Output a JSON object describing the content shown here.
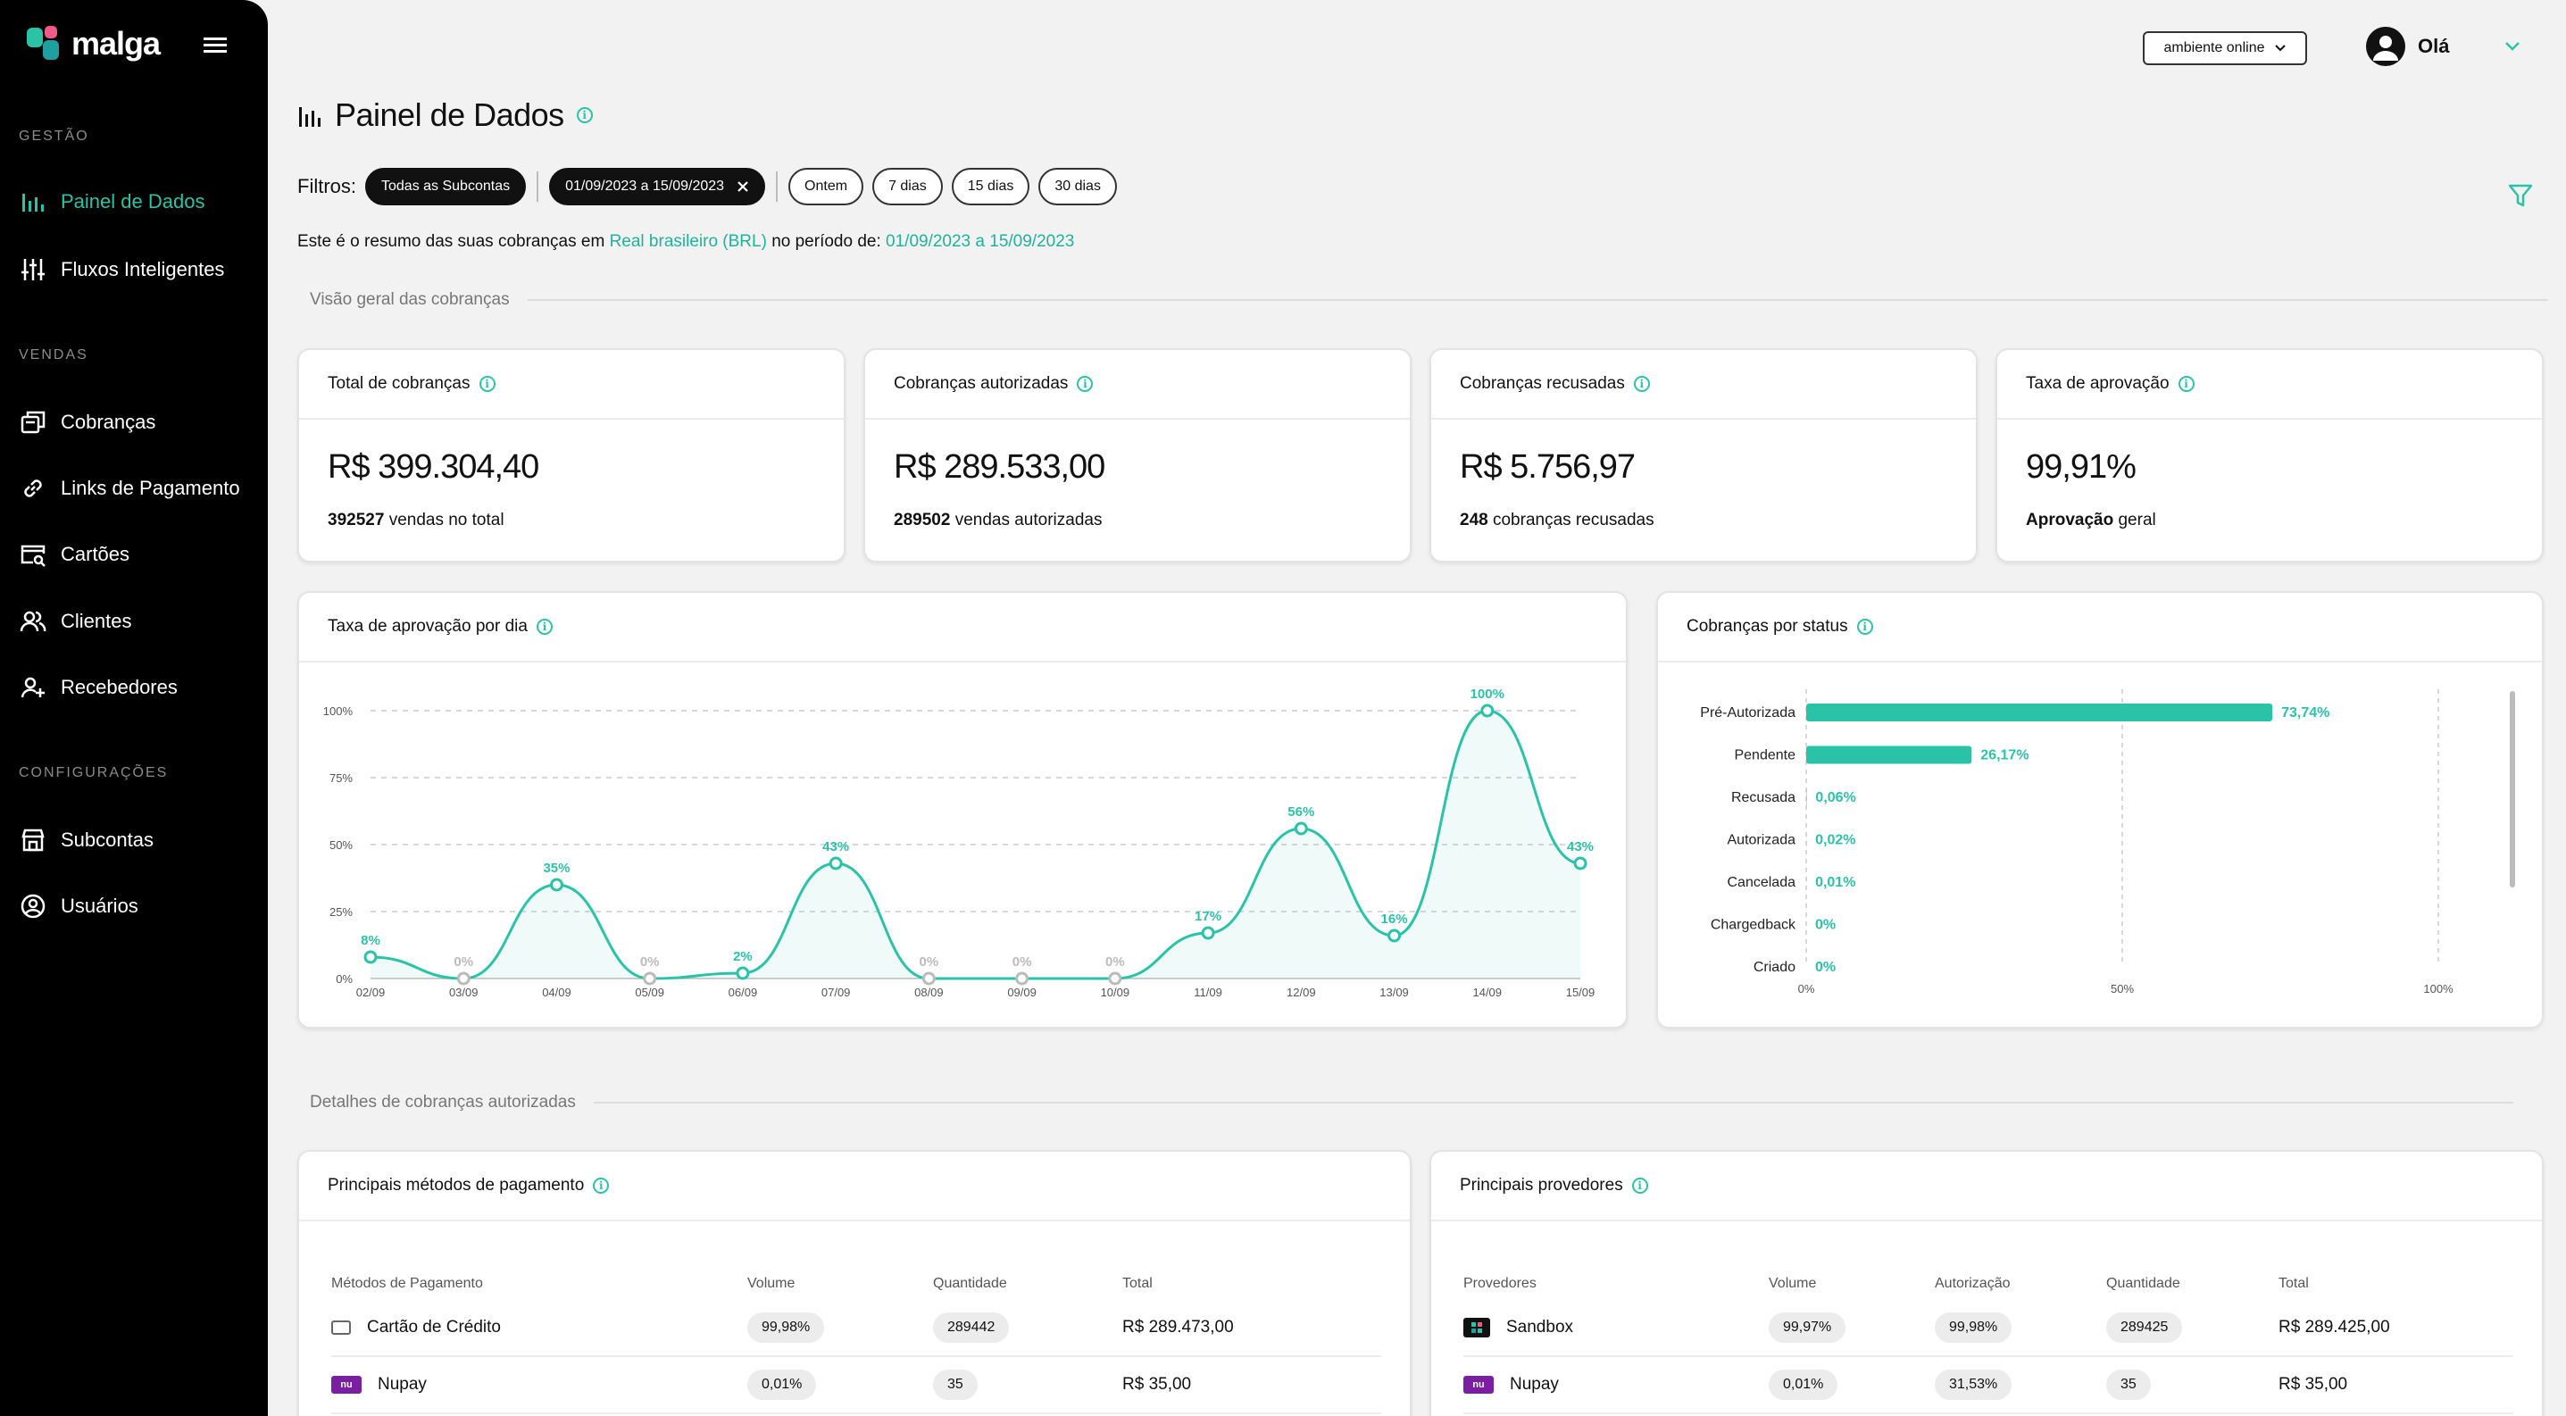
{
  "app": {
    "logo_text": "malga",
    "brand_color": "#2bc3a8"
  },
  "sidebar": {
    "sections": [
      {
        "title": "GESTÃO",
        "items": [
          {
            "label": "Painel de Dados",
            "icon": "bar-chart-icon",
            "active": true
          },
          {
            "label": "Fluxos Inteligentes",
            "icon": "sliders-icon",
            "active": false
          }
        ]
      },
      {
        "title": "VENDAS",
        "items": [
          {
            "label": "Cobranças",
            "icon": "charges-icon",
            "active": false
          },
          {
            "label": "Links de Pagamento",
            "icon": "link-icon",
            "active": false
          },
          {
            "label": "Cartões",
            "icon": "card-search-icon",
            "active": false
          },
          {
            "label": "Clientes",
            "icon": "users-icon",
            "active": false
          },
          {
            "label": "Recebedores",
            "icon": "user-add-icon",
            "active": false
          }
        ]
      },
      {
        "title": "CONFIGURAÇÕES",
        "items": [
          {
            "label": "Subcontas",
            "icon": "store-icon",
            "active": false
          },
          {
            "label": "Usuários",
            "icon": "user-circle-icon",
            "active": false
          }
        ]
      }
    ]
  },
  "header": {
    "environment": "ambiente online",
    "greeting": "Olá"
  },
  "page": {
    "title": "Painel de Dados"
  },
  "filters": {
    "label": "Filtros:",
    "subaccount": "Todas as Subcontas",
    "date_range": "01/09/2023 a 15/09/2023",
    "quick": [
      "Ontem",
      "7 dias",
      "15 dias",
      "30 dias"
    ]
  },
  "summary": {
    "prefix": "Este é o resumo das suas cobranças em",
    "currency": "Real brasileiro (BRL)",
    "middle": "no período de:",
    "period": "01/09/2023 a 15/09/2023"
  },
  "sections": {
    "overview": "Visão geral das cobranças",
    "details": "Detalhes de cobranças autorizadas"
  },
  "kpis": [
    {
      "title": "Total de cobranças",
      "value": "R$ 399.304,40",
      "sub_bold": "392527",
      "sub_text": "vendas no total"
    },
    {
      "title": "Cobranças autorizadas",
      "value": "R$ 289.533,00",
      "sub_bold": "289502",
      "sub_text": "vendas autorizadas"
    },
    {
      "title": "Cobranças recusadas",
      "value": "R$ 5.756,97",
      "sub_bold": "248",
      "sub_text": "cobranças recusadas"
    },
    {
      "title": "Taxa de aprovação",
      "value": "99,91%",
      "sub_bold": "Aprovação",
      "sub_text": "geral"
    }
  ],
  "line_card": {
    "title": "Taxa de aprovação por dia"
  },
  "bar_card": {
    "title": "Cobranças por status"
  },
  "chart_data": [
    {
      "type": "area",
      "title": "Taxa de aprovação por dia",
      "categories": [
        "02/09",
        "03/09",
        "04/09",
        "05/09",
        "06/09",
        "07/09",
        "08/09",
        "09/09",
        "10/09",
        "11/09",
        "12/09",
        "13/09",
        "14/09",
        "15/09"
      ],
      "values": [
        8,
        0,
        35,
        0,
        2,
        43,
        0,
        0,
        0,
        17,
        56,
        16,
        100,
        43
      ],
      "labels": [
        "8%",
        "0%",
        "35%",
        "0%",
        "2%",
        "43%",
        "0%",
        "0%",
        "0%",
        "17%",
        "56%",
        "16%",
        "100%",
        "43%"
      ],
      "y_ticks": [
        "0%",
        "25%",
        "50%",
        "75%",
        "100%"
      ],
      "ylim": [
        0,
        100
      ],
      "color": "#2bc3a8",
      "grid": true
    },
    {
      "type": "bar",
      "orientation": "horizontal",
      "title": "Cobranças por status",
      "categories": [
        "Pré-Autorizada",
        "Pendente",
        "Recusada",
        "Autorizada",
        "Cancelada",
        "Chargedback",
        "Criado"
      ],
      "values": [
        73.74,
        26.17,
        0.06,
        0.02,
        0.01,
        0,
        0
      ],
      "labels": [
        "73,74%",
        "26,17%",
        "0,06%",
        "0,02%",
        "0,01%",
        "0%",
        "0%"
      ],
      "x_ticks": [
        "0%",
        "50%",
        "100%"
      ],
      "xlim": [
        0,
        100
      ],
      "color": "#2bc3a8"
    }
  ],
  "methods_card": {
    "title": "Principais métodos de pagamento",
    "headers": [
      "Métodos de Pagamento",
      "Volume",
      "Quantidade",
      "Total"
    ],
    "rows": [
      {
        "name": "Cartão de Crédito",
        "icon": "credit-card-icon",
        "volume": "99,98%",
        "quantity": "289442",
        "total": "R$ 289.473,00"
      },
      {
        "name": "Nupay",
        "icon": "nupay-icon",
        "volume": "0,01%",
        "quantity": "35",
        "total": "R$ 35,00"
      }
    ]
  },
  "providers_card": {
    "title": "Principais provedores",
    "headers": [
      "Provedores",
      "Volume",
      "Autorização",
      "Quantidade",
      "Total"
    ],
    "rows": [
      {
        "name": "Sandbox",
        "icon": "sandbox-icon",
        "volume": "99,97%",
        "authorization": "99,98%",
        "quantity": "289425",
        "total": "R$ 289.425,00"
      },
      {
        "name": "Nupay",
        "icon": "nupay-icon",
        "volume": "0,01%",
        "authorization": "31,53%",
        "quantity": "35",
        "total": "R$ 35,00"
      }
    ]
  }
}
